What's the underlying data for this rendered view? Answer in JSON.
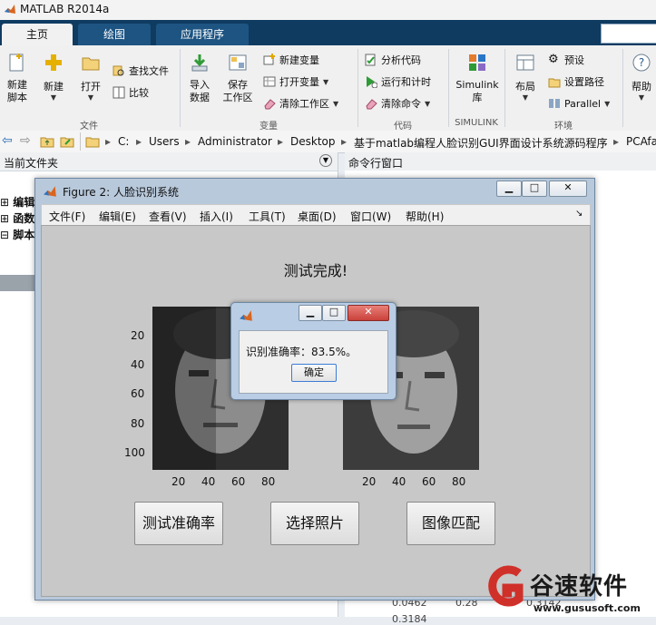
{
  "app": {
    "title": "MATLAB R2014a"
  },
  "main_tabs": [
    {
      "label": "主页"
    },
    {
      "label": "绘图"
    },
    {
      "label": "应用程序"
    }
  ],
  "ribbon": {
    "file_group": {
      "label": "文件",
      "new_script": "新建\n脚本",
      "new": "新建",
      "open": "打开",
      "find_files": "查找文件",
      "compare": "比较"
    },
    "variable_group": {
      "label": "变量",
      "import_data": "导入\n数据",
      "save_workspace": "保存\n工作区",
      "new_variable": "新建变量",
      "open_variable": "打开变量",
      "clear_workspace": "清除工作区"
    },
    "code_group": {
      "label": "代码",
      "analyze_code": "分析代码",
      "run_and_time": "运行和计时",
      "clear_commands": "清除命令"
    },
    "simulink_group": {
      "label": "SIMULINK",
      "simulink_library": "Simulink\n库"
    },
    "env_group": {
      "label": "环境",
      "layout": "布局",
      "preferences": "预设",
      "set_path": "设置路径",
      "parallel": "Parallel"
    },
    "help": "帮助"
  },
  "address": {
    "segments": [
      "C:",
      "Users",
      "Administrator",
      "Desktop",
      "基于matlab编程人脸识别GUI界面设计系统源码程序",
      "PCAfa"
    ]
  },
  "left_panel": {
    "title": "当前文件夹",
    "sections": [
      "编辑",
      "函数",
      "脚本"
    ]
  },
  "right_panel": {
    "title": "命令行窗口",
    "numbers": [
      "0.0462",
      "0.28",
      "0.3142",
      "0.3184"
    ]
  },
  "figure": {
    "title": "Figure 2: 人脸识别系统",
    "menu": [
      "文件(F)",
      "编辑(E)",
      "查看(V)",
      "插入(I)",
      "工具(T)",
      "桌面(D)",
      "窗口(W)",
      "帮助(H)"
    ],
    "status_text": "测试完成!",
    "y_ticks": [
      "20",
      "40",
      "60",
      "80",
      "100"
    ],
    "x_ticks": [
      "20",
      "40",
      "60",
      "80"
    ],
    "buttons": {
      "test_accuracy": "测试准确率",
      "choose_photo": "选择照片",
      "image_match": "图像匹配"
    }
  },
  "dialog": {
    "message": "识别准确率：83.5%。",
    "ok_label": "确定"
  },
  "watermark": {
    "name": "谷速软件",
    "url": "www.gususoft.com"
  },
  "colors": {
    "tab_bar": "#0f3b61",
    "figure_bg": "#c8c8c8",
    "dialog_close": "#c9413b"
  }
}
